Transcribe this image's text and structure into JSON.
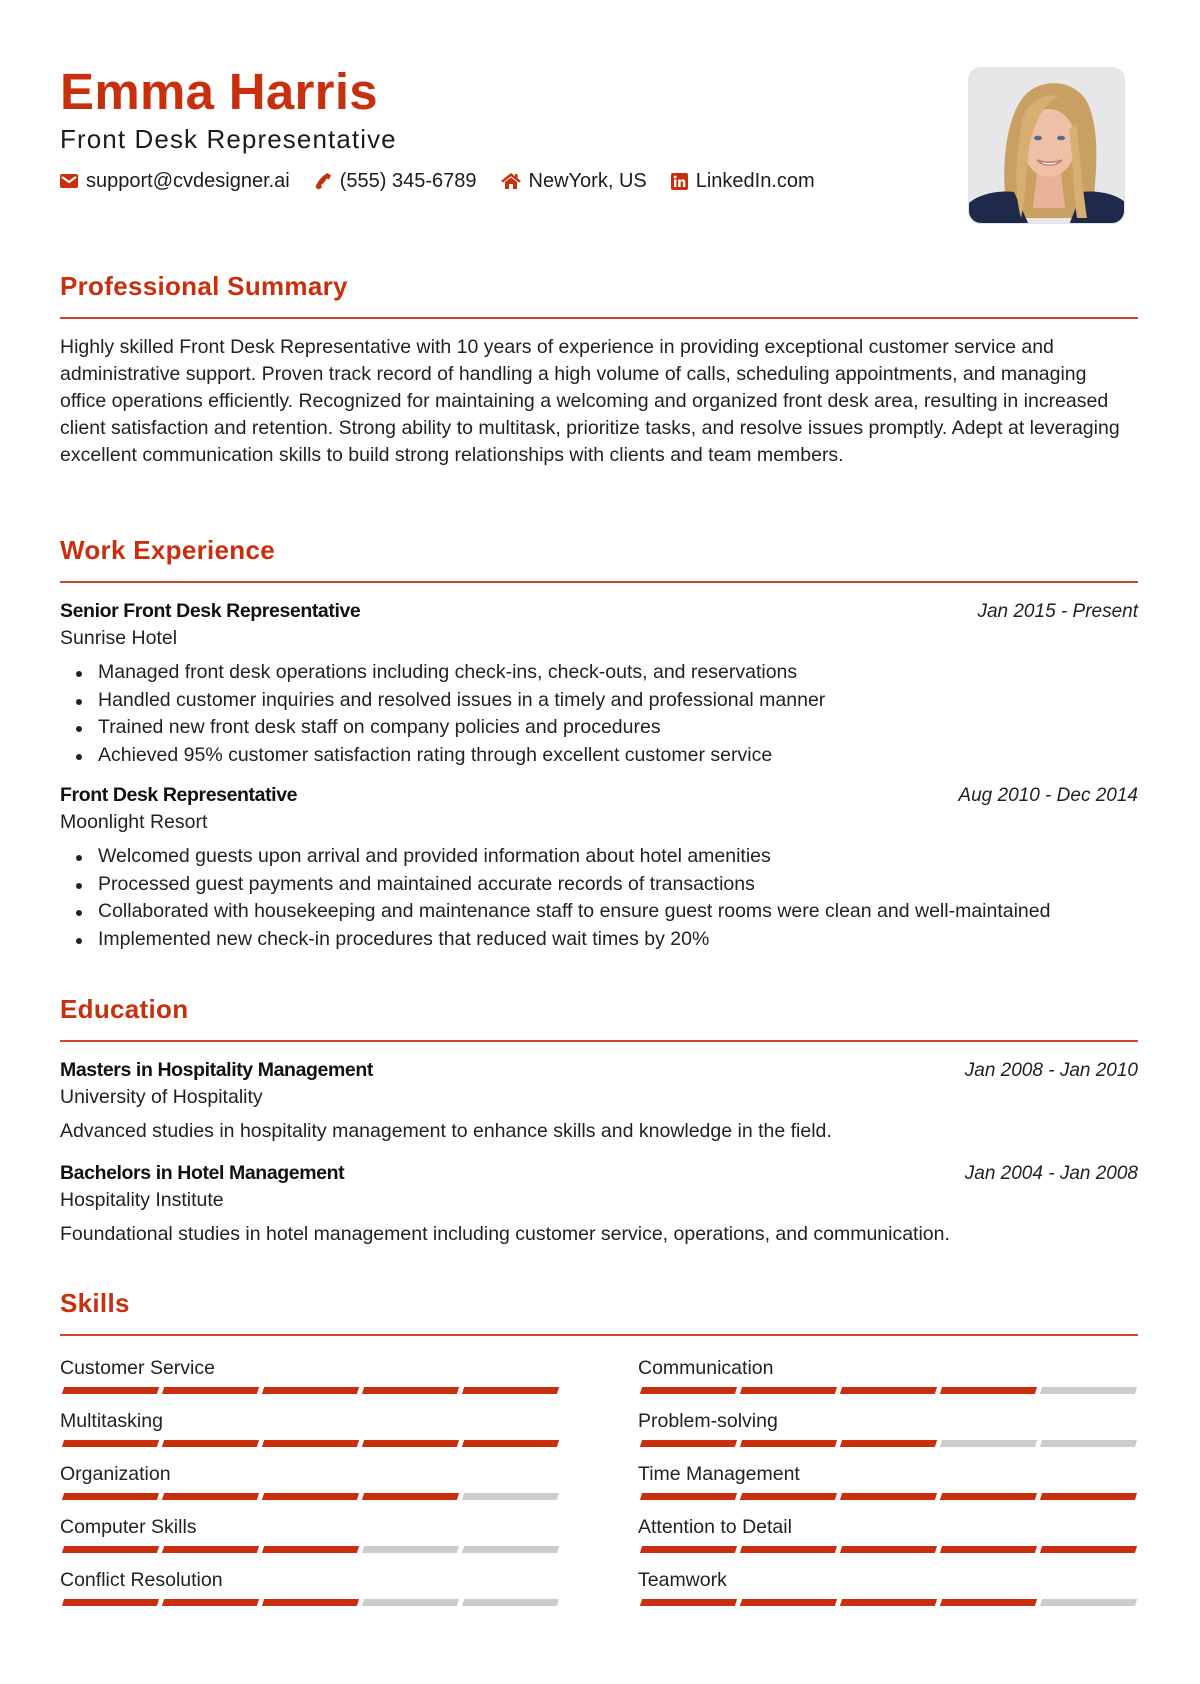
{
  "header": {
    "name": "Emma Harris",
    "title": "Front Desk Representative",
    "contacts": [
      {
        "icon": "envelope-icon",
        "text": "support@cvdesigner.ai"
      },
      {
        "icon": "phone-icon",
        "text": "(555) 345-6789"
      },
      {
        "icon": "home-icon",
        "text": "NewYork, US"
      },
      {
        "icon": "linkedin-icon",
        "text": "LinkedIn.com"
      }
    ],
    "photo_alt": "Profile photo of Emma Harris"
  },
  "colors": {
    "accent": "#c8300d",
    "rule": "#d0462a",
    "bar_empty": "#cccccc",
    "text": "#222222"
  },
  "summary": {
    "heading": "Professional Summary",
    "text": "Highly skilled Front Desk Representative with 10 years of experience in providing exceptional customer service and administrative support. Proven track record of handling a high volume of calls, scheduling appointments, and managing office operations efficiently. Recognized for maintaining a welcoming and organized front desk area, resulting in increased client satisfaction and retention. Strong ability to multitask, prioritize tasks, and resolve issues promptly. Adept at leveraging excellent communication skills to build strong relationships with clients and team members."
  },
  "work": {
    "heading": "Work Experience",
    "jobs": [
      {
        "title": "Senior Front Desk Representative",
        "company": "Sunrise Hotel",
        "dates": "Jan 2015 - Present",
        "bullets": [
          "Managed front desk operations including check-ins, check-outs, and reservations",
          "Handled customer inquiries and resolved issues in a timely and professional manner",
          "Trained new front desk staff on company policies and procedures",
          "Achieved 95% customer satisfaction rating through excellent customer service"
        ]
      },
      {
        "title": "Front Desk Representative",
        "company": "Moonlight Resort",
        "dates": "Aug 2010 - Dec 2014",
        "bullets": [
          "Welcomed guests upon arrival and provided information about hotel amenities",
          "Processed guest payments and maintained accurate records of transactions",
          "Collaborated with housekeeping and maintenance staff to ensure guest rooms were clean and well-maintained",
          "Implemented new check-in procedures that reduced wait times by 20%"
        ]
      }
    ]
  },
  "education": {
    "heading": "Education",
    "items": [
      {
        "degree": "Masters in Hospitality Management",
        "school": "University of Hospitality",
        "dates": "Jan 2008 - Jan 2010",
        "description": "Advanced studies in hospitality management to enhance skills and knowledge in the field."
      },
      {
        "degree": "Bachelors in Hotel Management",
        "school": "Hospitality Institute",
        "dates": "Jan 2004 - Jan 2008",
        "description": "Foundational studies in hotel management including customer service, operations, and communication."
      }
    ]
  },
  "skills": {
    "heading": "Skills",
    "max_level": 5,
    "items": [
      {
        "name": "Customer Service",
        "level": 5
      },
      {
        "name": "Communication",
        "level": 4
      },
      {
        "name": "Multitasking",
        "level": 5
      },
      {
        "name": "Problem-solving",
        "level": 3
      },
      {
        "name": "Organization",
        "level": 4
      },
      {
        "name": "Time Management",
        "level": 5
      },
      {
        "name": "Computer Skills",
        "level": 3
      },
      {
        "name": "Attention to Detail",
        "level": 5
      },
      {
        "name": "Conflict Resolution",
        "level": 3
      },
      {
        "name": "Teamwork",
        "level": 4
      }
    ]
  }
}
